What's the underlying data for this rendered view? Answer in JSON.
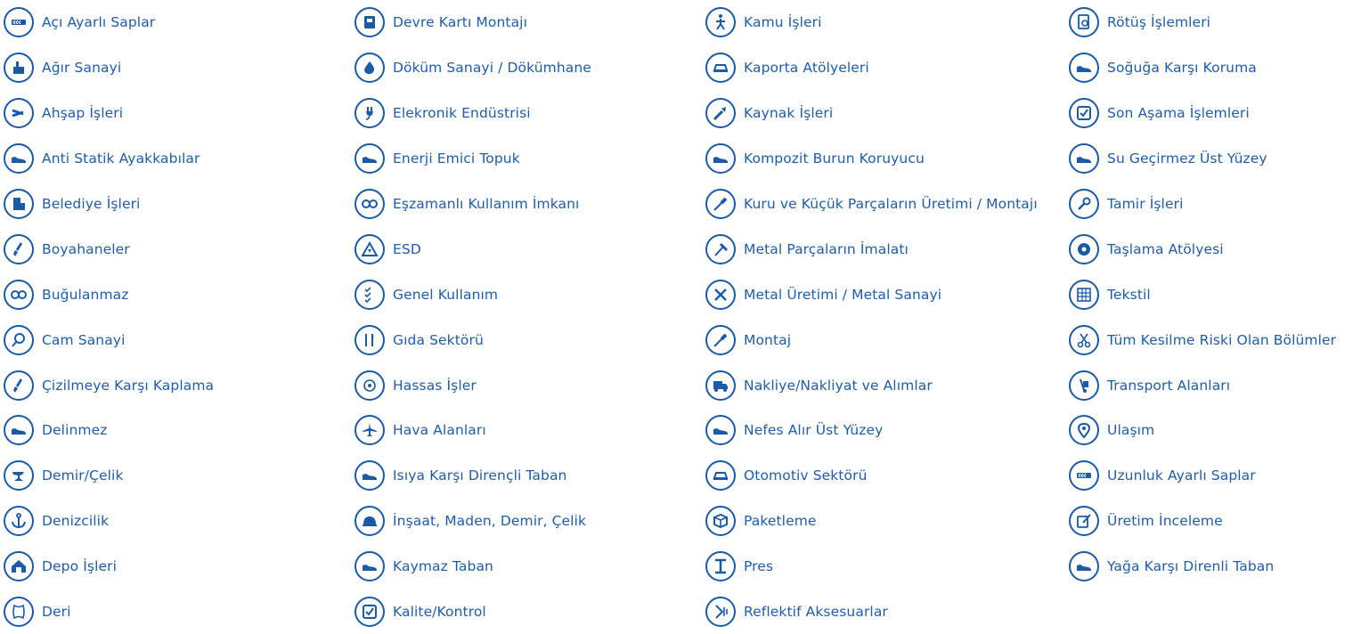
{
  "accent_color": "#1a5aa6",
  "columns": [
    {
      "items": [
        {
          "label": "Açı Ayarlı Saplar",
          "icon": "adjustable-handle-icon"
        },
        {
          "label": "Ağır Sanayi",
          "icon": "heavy-industry-icon"
        },
        {
          "label": "Ahşap İşleri",
          "icon": "woodwork-icon"
        },
        {
          "label": "Anti Statik Ayakkabılar",
          "icon": "antistatic-shoe-icon"
        },
        {
          "label": "Belediye İşleri",
          "icon": "municipal-building-icon"
        },
        {
          "label": "Boyahaneler",
          "icon": "paint-brush-icon"
        },
        {
          "label": "Buğulanmaz",
          "icon": "anti-fog-icon"
        },
        {
          "label": "Cam Sanayi",
          "icon": "magnifier-icon"
        },
        {
          "label": "Çizilmeye Karşı Kaplama",
          "icon": "scratch-resistant-icon"
        },
        {
          "label": "Delinmez",
          "icon": "puncture-proof-shoe-icon"
        },
        {
          "label": "Demir/Çelik",
          "icon": "anvil-icon"
        },
        {
          "label": "Denizcilik",
          "icon": "anchor-icon"
        },
        {
          "label": "Depo İşleri",
          "icon": "warehouse-icon"
        },
        {
          "label": "Deri",
          "icon": "leather-icon"
        }
      ]
    },
    {
      "items": [
        {
          "label": "Devre Kartı Montajı",
          "icon": "circuit-board-icon"
        },
        {
          "label": "Döküm Sanayi / Dökümhane",
          "icon": "foundry-icon"
        },
        {
          "label": "Elekronik Endüstrisi",
          "icon": "plug-icon"
        },
        {
          "label": "Enerji Emici Topuk",
          "icon": "shock-absorbing-heel-icon"
        },
        {
          "label": "Eşzamanlı Kullanım İmkanı",
          "icon": "glasses-icon"
        },
        {
          "label": "ESD",
          "icon": "esd-warning-icon"
        },
        {
          "label": "Genel Kullanım",
          "icon": "checklist-icon"
        },
        {
          "label": "Gıda Sektörü",
          "icon": "fork-knife-icon"
        },
        {
          "label": "Hassas İşler",
          "icon": "precision-icon"
        },
        {
          "label": "Hava Alanları",
          "icon": "airplane-icon"
        },
        {
          "label": "Isıya Karşı Dirençli Taban",
          "icon": "heat-resistant-sole-icon"
        },
        {
          "label": "İnşaat, Maden, Demir, Çelik",
          "icon": "hard-hat-icon"
        },
        {
          "label": "Kaymaz Taban",
          "icon": "non-slip-sole-icon"
        },
        {
          "label": "Kalite/Kontrol",
          "icon": "checkbox-icon"
        }
      ]
    },
    {
      "items": [
        {
          "label": "Kamu İşleri",
          "icon": "pedestrian-icon"
        },
        {
          "label": "Kaporta Atölyeleri",
          "icon": "car-body-icon"
        },
        {
          "label": "Kaynak İşleri",
          "icon": "welding-icon"
        },
        {
          "label": "Kompozit Burun Koruyucu",
          "icon": "composite-toe-icon"
        },
        {
          "label": "Kuru ve Küçük Parçaların Üretimi / Montajı",
          "icon": "screwdriver-icon"
        },
        {
          "label": "Metal Parçaların İmalatı",
          "icon": "hammer-icon"
        },
        {
          "label": "Metal Üretimi / Metal Sanayi",
          "icon": "tools-cross-icon"
        },
        {
          "label": "Montaj",
          "icon": "screwdriver-thin-icon"
        },
        {
          "label": "Nakliye/Nakliyat ve Alımlar",
          "icon": "truck-icon"
        },
        {
          "label": "Nefes Alır Üst Yüzey",
          "icon": "breathable-shoe-icon"
        },
        {
          "label": "Otomotiv Sektörü",
          "icon": "car-icon"
        },
        {
          "label": "Paketleme",
          "icon": "package-icon"
        },
        {
          "label": "Pres",
          "icon": "i-beam-icon"
        },
        {
          "label": "Reflektif Aksesuarlar",
          "icon": "reflective-icon"
        }
      ]
    },
    {
      "items": [
        {
          "label": "Rötüş İşlemleri",
          "icon": "retouch-icon"
        },
        {
          "label": "Soğuğa Karşı Koruma",
          "icon": "cold-protection-shoe-icon"
        },
        {
          "label": "Son Aşama İşlemleri",
          "icon": "final-check-icon"
        },
        {
          "label": "Su Geçirmez Üst Yüzey",
          "icon": "waterproof-shoe-icon"
        },
        {
          "label": "Tamir İşleri",
          "icon": "wrench-icon"
        },
        {
          "label": "Taşlama Atölyesi",
          "icon": "grinding-disc-icon"
        },
        {
          "label": "Tekstil",
          "icon": "textile-icon"
        },
        {
          "label": "Tüm Kesilme Riski Olan Bölümler",
          "icon": "scissors-icon"
        },
        {
          "label": "Transport Alanları",
          "icon": "hand-truck-icon"
        },
        {
          "label": "Ulaşım",
          "icon": "location-pin-icon"
        },
        {
          "label": "Uzunluk Ayarlı Saplar",
          "icon": "length-adjustable-icon"
        },
        {
          "label": "Üretim İnceleme",
          "icon": "edit-icon"
        },
        {
          "label": "Yağa Karşı Direnli Taban",
          "icon": "oil-resistant-sole-icon"
        }
      ]
    }
  ]
}
